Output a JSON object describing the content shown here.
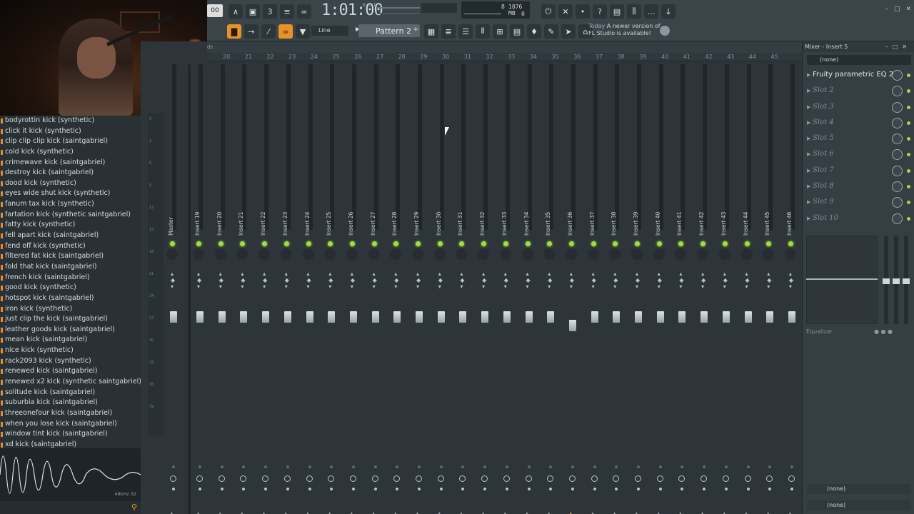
{
  "toolbar": {
    "tempo": "00",
    "time": "1:01:00",
    "time_sub": "B:S:T",
    "cpu_voices": "8",
    "cpu_mem": "1876 MB",
    "cpu_zero": "0",
    "snap": "Line",
    "pattern": "Pattern 2",
    "news_line1": "Today",
    "news_line2": "A newer version of",
    "news_line3": "FL Studio is available!"
  },
  "browser": {
    "items": [
      "bodyrottin kick (synthetic)",
      "click it kick (synthetic)",
      "clip clip clip kick (saintgabriel)",
      "cold kick (synthetic)",
      "crimewave kick (saintgabriel)",
      "destroy kick (saintgabriel)",
      "dood kick (synthetic)",
      "eyes wide shut kick (synthetic)",
      "fanum tax kick (synthetic)",
      "fartation kick (synthetic saintgabriel)",
      "fatty kick (synthetic)",
      "fell apart kick (saintgabriel)",
      "fend off kick (synthetic)",
      "filtered fat kick (saintgabriel)",
      "fold that kick (saintgabriel)",
      "french kick (saintgabriel)",
      "good kick (synthetic)",
      "hotspot kick (saintgabriel)",
      "iron kick (synthetic)",
      "just clip the kick (saintgabriel)",
      "leather goods kick (saintgabriel)",
      "mean kick (saintgabriel)",
      "nice kick (synthetic)",
      "rack2093 kick (synthetic)",
      "renewed kick (saintgabriel)",
      "renewed x2 kick (synthetic saintgabriel)",
      "solitude kick (saintgabriel)",
      "suburbia kick (saintgabriel)",
      "threeonefour kick (saintgabriel)",
      "when you lose kick (saintgabriel)",
      "window tint kick (saintgabriel)",
      "xd kick (saintgabriel)"
    ],
    "wave_info": "48kHz 32"
  },
  "mixer": {
    "header_label": "de",
    "ruler": [
      "20",
      "21",
      "22",
      "23",
      "24",
      "25",
      "26",
      "27",
      "28",
      "29",
      "30",
      "31",
      "32",
      "33",
      "34",
      "35",
      "36",
      "37",
      "38",
      "39",
      "40",
      "41",
      "42",
      "43",
      "44",
      "45"
    ],
    "strips": [
      "Master",
      "Insert 19",
      "Insert 20",
      "Insert 21",
      "Insert 22",
      "Insert 23",
      "Insert 24",
      "Insert 25",
      "Insert 26",
      "Insert 27",
      "Insert 28",
      "Insert 29",
      "Insert 30",
      "Insert 31",
      "Insert 32",
      "Insert 33",
      "Insert 34",
      "Insert 35",
      "Insert 36",
      "Insert 37",
      "Insert 38",
      "Insert 39",
      "Insert 40",
      "Insert 41",
      "Insert 42",
      "Insert 43",
      "Insert 44",
      "Insert 45",
      "Insert 46"
    ],
    "left_scale": [
      "0",
      "3",
      "6",
      "9",
      "12",
      "15",
      "18",
      "21",
      "24",
      "27",
      "30",
      "33",
      "36",
      "39"
    ]
  },
  "panel": {
    "title": "Mixer - Insert 5",
    "input": "(none)",
    "slots": [
      "Fruity parametric EQ 2",
      "Slot 2",
      "Slot 3",
      "Slot 4",
      "Slot 5",
      "Slot 6",
      "Slot 7",
      "Slot 8",
      "Slot 9",
      "Slot 10"
    ],
    "eq_label": "Equalizer",
    "output1": "(none)",
    "output2": "(none)"
  }
}
